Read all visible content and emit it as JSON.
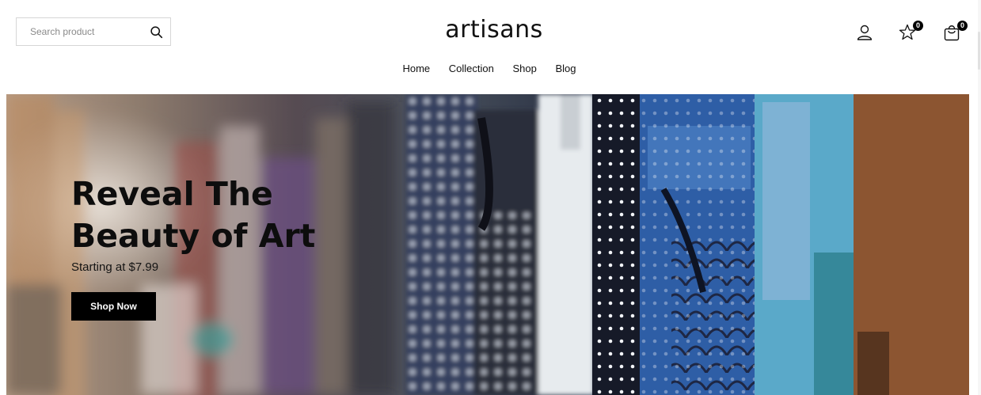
{
  "header": {
    "search": {
      "placeholder": "Search product",
      "icon": "search-icon"
    },
    "logo": "artisans",
    "icons": {
      "account": "user-icon",
      "wishlist": {
        "icon": "star-icon",
        "count": "0"
      },
      "cart": {
        "icon": "shopping-bag-icon",
        "count": "0"
      }
    }
  },
  "nav": {
    "items": [
      {
        "label": "Home"
      },
      {
        "label": "Collection"
      },
      {
        "label": "Shop"
      },
      {
        "label": "Blog"
      }
    ]
  },
  "hero": {
    "title_line1": "Reveal The",
    "title_line2": "Beauty of Art",
    "subtitle": "Starting at $7.99",
    "cta": "Shop Now"
  }
}
